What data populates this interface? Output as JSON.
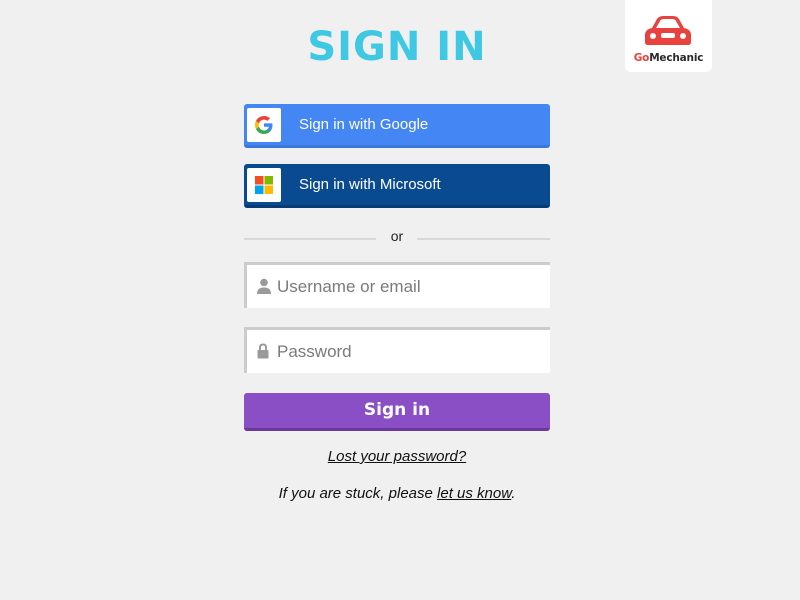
{
  "header": {
    "title": "SIGN IN"
  },
  "logo": {
    "brand_part1": "Go",
    "brand_part2": "Mechanic",
    "icon": "car-icon",
    "color": "#e8413e"
  },
  "sso": {
    "google": {
      "label": "Sign in with Google",
      "icon": "google-icon",
      "color": "#4486f4"
    },
    "microsoft": {
      "label": "Sign in with Microsoft",
      "icon": "microsoft-icon",
      "color": "#0a4a91"
    }
  },
  "divider": {
    "text": "or"
  },
  "form": {
    "username": {
      "placeholder": "Username or email",
      "value": "",
      "icon": "user-icon"
    },
    "password": {
      "placeholder": "Password",
      "value": "",
      "icon": "lock-icon"
    },
    "submit_label": "Sign in",
    "submit_color": "#8a4fc4"
  },
  "footer": {
    "lost_password": "Lost your password?",
    "stuck_prefix": "If you are stuck, please ",
    "stuck_link": "let us know",
    "stuck_suffix": "."
  },
  "colors": {
    "accent": "#3ec8e3",
    "background": "#f0f0f0"
  }
}
